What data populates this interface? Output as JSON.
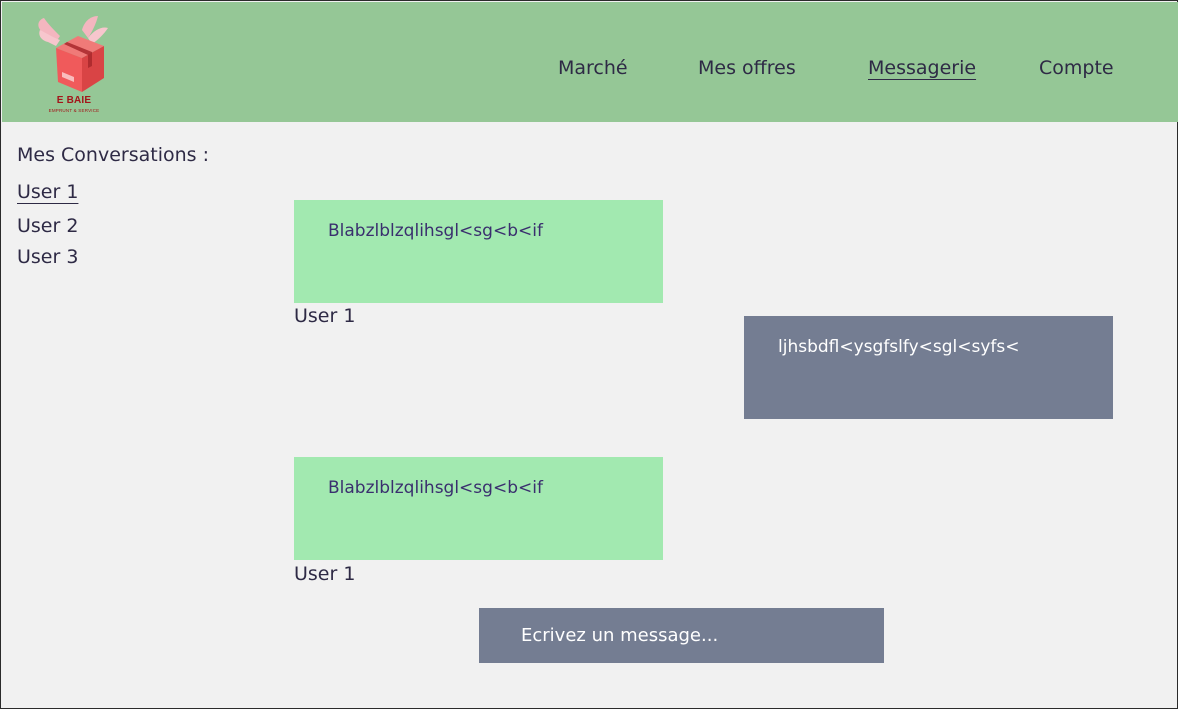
{
  "logo": {
    "title": "E BAIE",
    "subtitle": "EMPRUNT & SERVICE",
    "colors": {
      "box": "#f05a5b",
      "box_dark": "#c9393c",
      "wing": "#f4b6bf",
      "text": "#a3161a"
    }
  },
  "nav": {
    "items": [
      {
        "label": "Marché"
      },
      {
        "label": "Mes offres"
      },
      {
        "label": "Messagerie",
        "active": true
      },
      {
        "label": "Compte"
      }
    ]
  },
  "sidebar": {
    "title": "Mes Conversations :",
    "conversations": [
      {
        "label": "User 1",
        "active": true
      },
      {
        "label": "User 2"
      },
      {
        "label": "User 3"
      }
    ]
  },
  "messages": [
    {
      "text": "Blabzlblzqlihsgl<sg<b<if",
      "sender": "User 1",
      "direction": "incoming"
    },
    {
      "text": "ljhsbdfl<ysgfslfy<sgl<syfs<",
      "direction": "outgoing"
    },
    {
      "text": "Blabzlblzqlihsgl<sg<b<if",
      "sender": "User 1",
      "direction": "incoming"
    }
  ],
  "composer": {
    "placeholder": "Ecrivez un message..."
  },
  "colors": {
    "header_bg": "#95c796",
    "page_bg": "#f1f1f1",
    "incoming_bubble": "#a2e9b0",
    "outgoing_bubble": "#747d92",
    "text": "#2e2a45"
  }
}
